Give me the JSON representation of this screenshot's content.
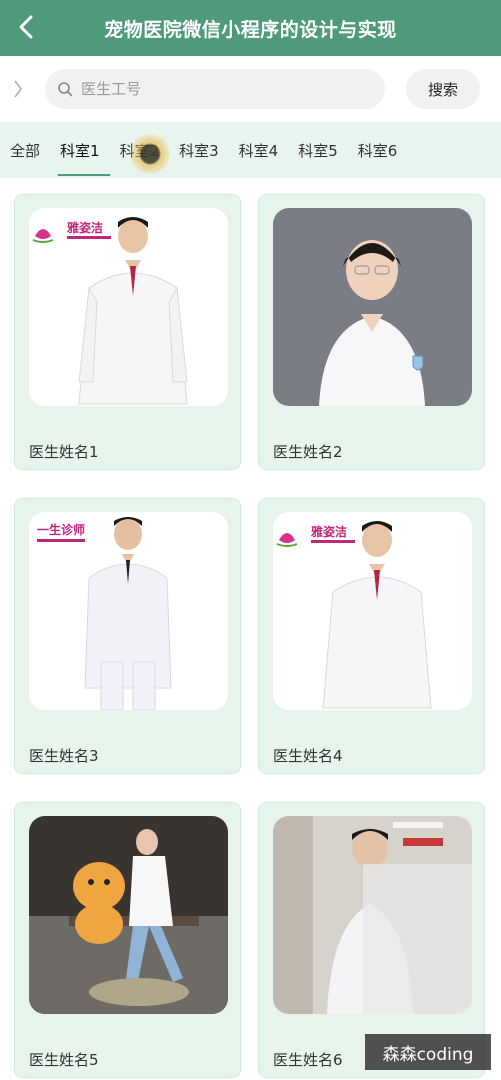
{
  "header": {
    "title": "宠物医院微信小程序的设计与实现"
  },
  "search": {
    "placeholder": "医生工号",
    "button_label": "搜索"
  },
  "tabs": [
    {
      "label": "全部"
    },
    {
      "label": "科室1"
    },
    {
      "label": "科室2"
    },
    {
      "label": "科室3"
    },
    {
      "label": "科室4"
    },
    {
      "label": "科室5"
    },
    {
      "label": "科室6"
    }
  ],
  "active_tab": "科室1",
  "doctors": [
    {
      "name": "医生姓名1",
      "logo_text": "雅姿洁"
    },
    {
      "name": "医生姓名2"
    },
    {
      "name": "医生姓名3",
      "logo_text": "一生诊师"
    },
    {
      "name": "医生姓名4",
      "logo_text": "雅姿洁"
    },
    {
      "name": "医生姓名5"
    },
    {
      "name": "医生姓名6"
    }
  ],
  "watermark": "森森coding",
  "colors": {
    "header": "#4e9a7b",
    "card_bg": "#e6f4ec",
    "tabs_bg": "#e8f4ee"
  }
}
